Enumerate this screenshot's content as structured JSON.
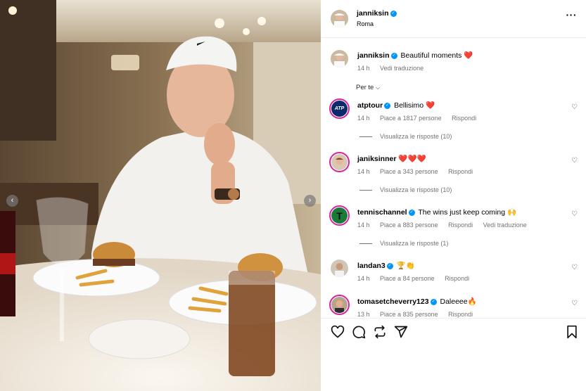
{
  "post": {
    "author": "janniksin",
    "location": "Roma",
    "caption": "Beautiful moments",
    "caption_emoji": "❤️",
    "time": "14 h",
    "translate": "Vedi traduzione",
    "more_icon": "more-options-icon"
  },
  "filter_label": "Per te",
  "comments": [
    {
      "user": "atptour",
      "verified": true,
      "text": "Bellisimo",
      "emoji": "❤️",
      "time": "14 h",
      "likes": "Piace a 1817 persone",
      "reply": "Rispondi",
      "replies": "Visualizza le risposte (10)",
      "avatar_text": "ATP",
      "avatar_bg": "#0b2a6b"
    },
    {
      "user": "janiksinner",
      "verified": false,
      "text": "",
      "emoji": "❤️❤️❤️",
      "time": "14 h",
      "likes": "Piace a 343 persone",
      "reply": "Rispondi",
      "replies": "Visualizza le risposte (10)",
      "avatar_bg": "#d9c7b0"
    },
    {
      "user": "tennischannel",
      "verified": true,
      "text": "The wins just keep coming",
      "emoji": "🙌",
      "time": "14 h",
      "likes": "Piace a 883 persone",
      "reply": "Rispondi",
      "translate": "Vedi traduzione",
      "replies": "Visualizza le risposte (1)",
      "avatar_text": "T",
      "avatar_bg": "#1b7a3a"
    },
    {
      "user": "landan3",
      "verified": true,
      "text": "",
      "emoji": "🏆👏",
      "time": "14 h",
      "likes": "Piace a 84 persone",
      "reply": "Rispondi",
      "avatar_bg": "#cfc6b8"
    },
    {
      "user": "tomasetcheverry123",
      "verified": true,
      "text": "Daleeee",
      "emoji": "🔥",
      "time": "13 h",
      "likes": "Piace a 835 persone",
      "reply": "Rispondi",
      "avatar_bg": "#b8a48c"
    }
  ],
  "actions": [
    "like-icon",
    "comment-icon",
    "share-icon",
    "send-icon",
    "save-icon"
  ],
  "colors": {
    "verified": "#0095f6",
    "meta": "#737373",
    "story_ring": "#d6249f"
  }
}
